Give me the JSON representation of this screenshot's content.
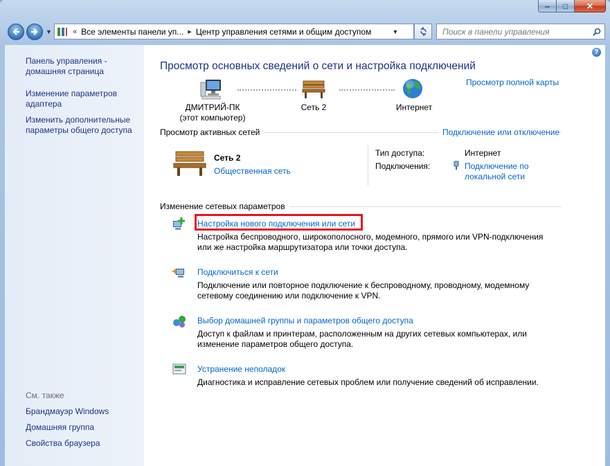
{
  "window": {
    "caption_buttons": {
      "minimize": "‒",
      "maximize": "□",
      "close": "✕"
    },
    "colors": {
      "accent": "#1e3287",
      "link": "#0066cc",
      "highlight": "#e8141c"
    }
  },
  "navigation": {
    "back_icon": "back-arrow-icon",
    "forward_icon": "forward-arrow-icon"
  },
  "address_bar": {
    "breadcrumbs": [
      "Все элементы панели уп...",
      "Центр управления сетями и общим доступом"
    ]
  },
  "search": {
    "placeholder": "Поиск в панели управления"
  },
  "sidebar": {
    "links": [
      "Панель управления - домашняя страница",
      "Изменение параметров адаптера",
      "Изменить дополнительные параметры общего доступа"
    ],
    "see_also_label": "См. также",
    "see_also": [
      "Брандмауэр Windows",
      "Домашняя группа",
      "Свойства браузера"
    ]
  },
  "main": {
    "title": "Просмотр основных сведений о сети и настройка подключений",
    "full_map_link": "Просмотр полной карты",
    "map": {
      "computer_name": "ДМИТРИЙ-ПК",
      "computer_subtitle": "(этот компьютер)",
      "network_name": "Сеть  2",
      "internet_label": "Интернет"
    },
    "active_networks": {
      "heading": "Просмотр активных сетей",
      "connect_link": "Подключение или отключение",
      "network_name": "Сеть  2",
      "network_type_link": "Общественная сеть",
      "access_type_label": "Тип доступа:",
      "access_type_value": "Интернет",
      "connections_label": "Подключения:",
      "connection_link_line1": "Подключение по",
      "connection_link_line2": "локальной сети"
    },
    "change_settings": {
      "heading": "Изменение сетевых параметров",
      "tasks": [
        {
          "link": "Настройка нового подключения или сети",
          "desc1": "Настройка беспроводного, широкополосного, модемного, прямого или VPN-подключения",
          "desc2": "или же настройка маршрутизатора или точки доступа."
        },
        {
          "link": "Подключиться к сети",
          "desc1": "Подключение или повторное подключение к беспроводному, проводному, модемному",
          "desc2": "сетевому соединению или подключение к VPN."
        },
        {
          "link": "Выбор домашней группы и параметров общего доступа",
          "desc1": "Доступ к файлам и принтерам, расположенным на других сетевых компьютерах, или",
          "desc2": "изменение параметров общего доступа."
        },
        {
          "link": "Устранение неполадок",
          "desc1": "Диагностика и исправление сетевых проблем или получение сведений об исправлении."
        }
      ]
    }
  }
}
